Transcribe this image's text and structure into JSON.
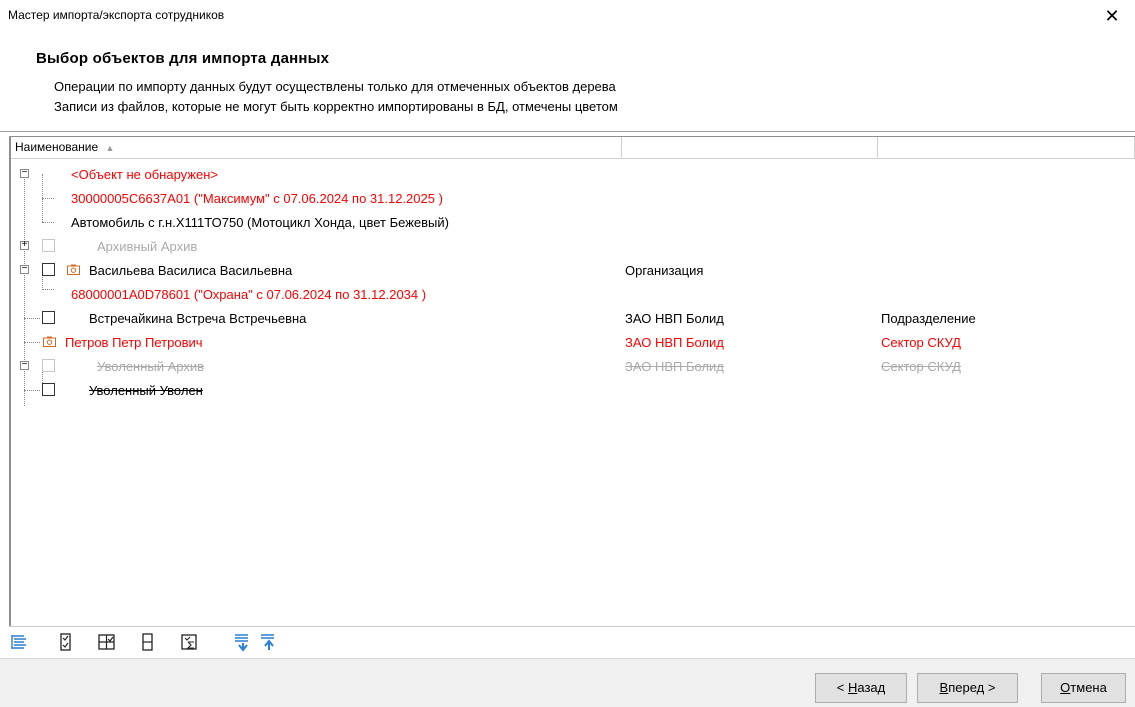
{
  "window": {
    "title": "Мастер импорта/экспорта сотрудников",
    "close_glyph": "✕"
  },
  "header": {
    "title": "Выбор объектов для импорта данных",
    "line1": "Операции по импорту данных будут осуществлены только для отмеченных объектов дерева",
    "line2": "Записи из файлов, которые не могут быть корректно импортированы в БД, отмечены цветом"
  },
  "grid": {
    "columns": [
      "Наименование",
      "",
      ""
    ],
    "sort_indicator": "▲",
    "rows": [
      {
        "name": "<Объект не обнаружен>",
        "col2": "",
        "col3": ""
      },
      {
        "name": "30000005C6637A01 (\"Максимум\" с 07.06.2024  по 31.12.2025 )",
        "col2": "",
        "col3": ""
      },
      {
        "name": "Автомобиль с г.н.Х111ТО750 (Мотоцикл Хонда, цвет Бежевый)",
        "col2": "",
        "col3": ""
      },
      {
        "name": "Архивный Архив",
        "col2": "",
        "col3": ""
      },
      {
        "name": "Васильева Василиса Васильевна",
        "col2": "Организация",
        "col3": ""
      },
      {
        "name": "68000001A0D78601 (\"Охрана\" с 07.06.2024  по 31.12.2034 )",
        "col2": "",
        "col3": ""
      },
      {
        "name": "Встречайкина Встреча Встречьевна",
        "col2": "ЗАО НВП Болид",
        "col3": "Подразделение"
      },
      {
        "name": "Петров Петр Петрович",
        "col2": "ЗАО НВП Болид",
        "col3": "Сектор СКУД"
      },
      {
        "name": "Уволенный Архив",
        "col2": "ЗАО НВП Болид",
        "col3": "Сектор СКУД"
      },
      {
        "name": "Уволенный Уволен",
        "col2": "",
        "col3": ""
      }
    ]
  },
  "toolbar": {
    "icons": [
      "tree-expand-icon",
      "check-all-icon",
      "check-tree-icon",
      "uncheck-icon",
      "check-invert-icon",
      "move-down-icon",
      "move-up-icon"
    ]
  },
  "footer": {
    "back": {
      "prefix": "< ",
      "key": "Н",
      "rest": "азад"
    },
    "next": {
      "prefix": "",
      "key": "В",
      "rest": "перед >"
    },
    "cancel": {
      "prefix": "",
      "key": "О",
      "rest": "тмена"
    }
  },
  "colors": {
    "error": "#ff0000",
    "disabled": "#aaaaaa",
    "camera": "#d2691e",
    "arrow": "#2a7fd4"
  }
}
